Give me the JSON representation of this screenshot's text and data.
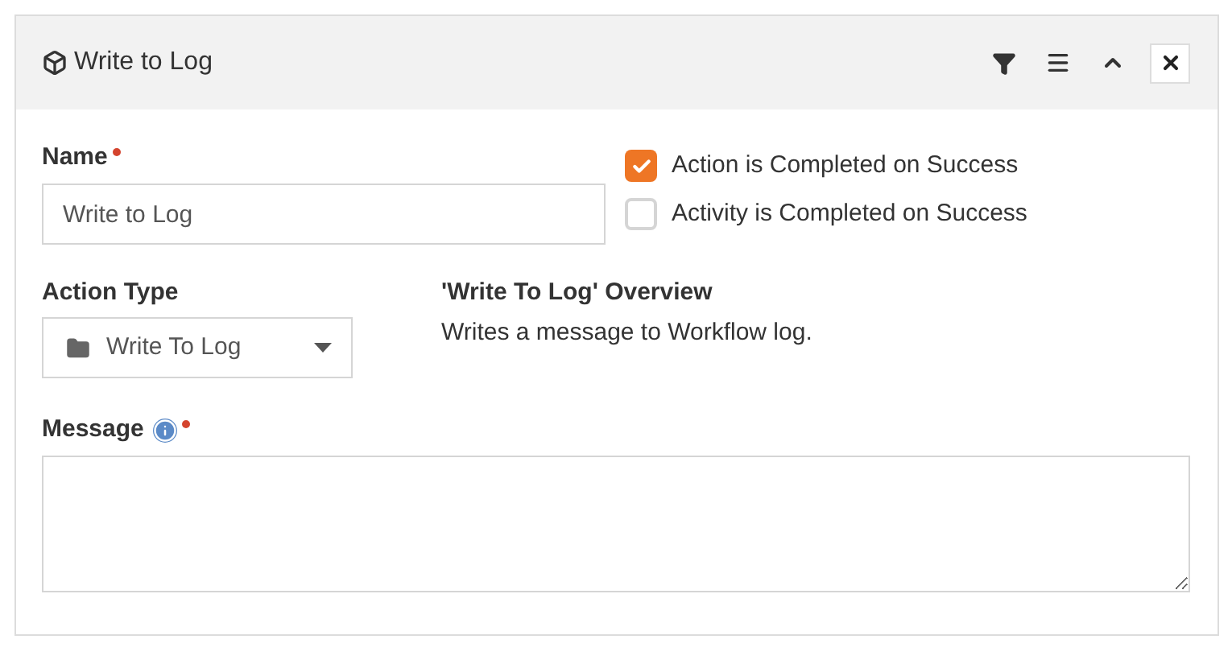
{
  "panel": {
    "title": "Write to Log"
  },
  "name_field": {
    "label": "Name",
    "required": true,
    "value": "Write to Log"
  },
  "options": [
    {
      "label": "Action is Completed on Success",
      "checked": true
    },
    {
      "label": "Activity is Completed on Success",
      "checked": false
    }
  ],
  "action_type": {
    "label": "Action Type",
    "value": "Write To Log"
  },
  "overview": {
    "title": "'Write To Log' Overview",
    "text": "Writes a message to Workflow log."
  },
  "message_field": {
    "label": "Message",
    "required": true
  }
}
